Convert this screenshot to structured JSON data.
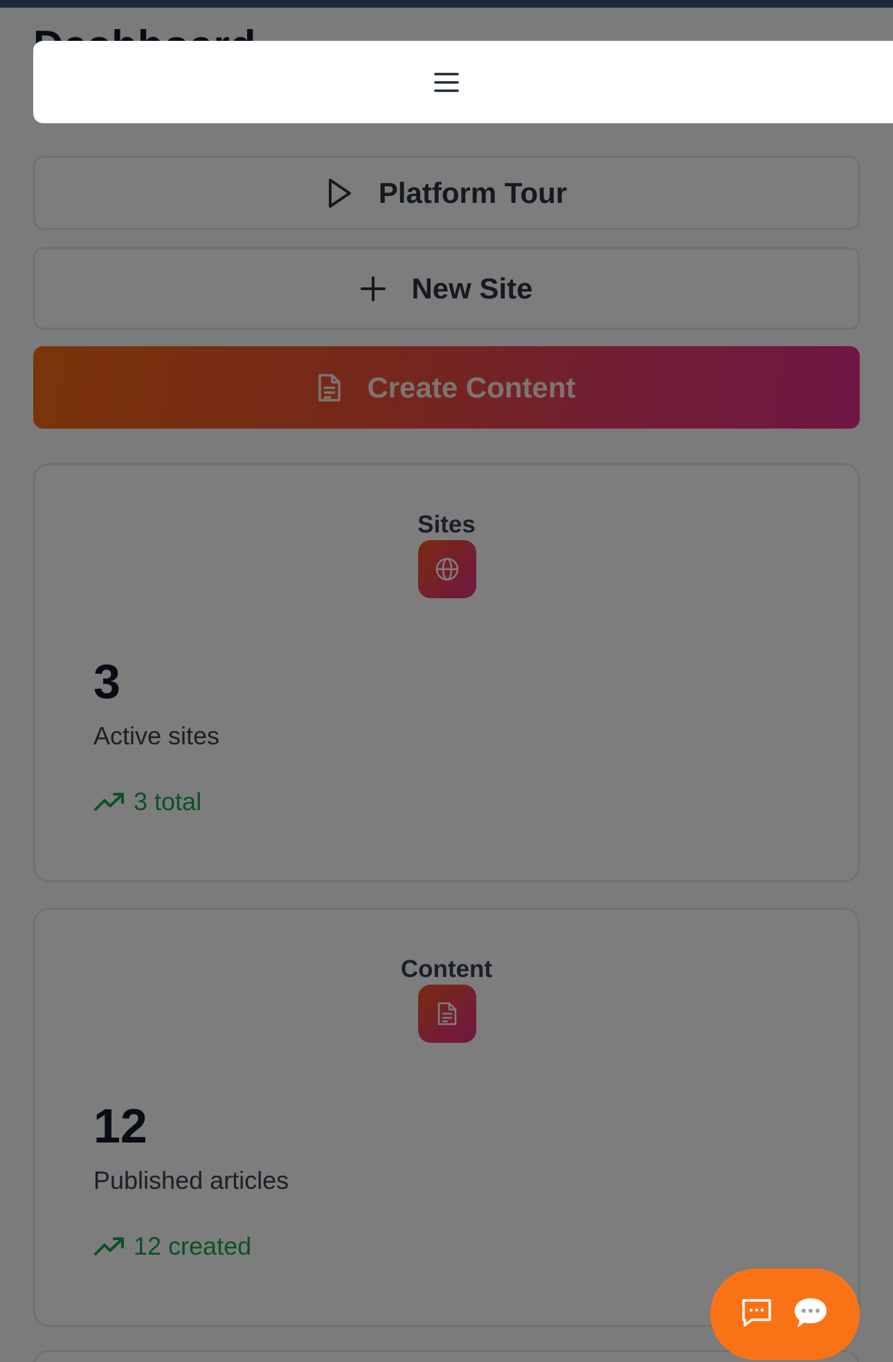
{
  "page": {
    "title": "Dashboard"
  },
  "actions": {
    "tour_label": "Platform Tour",
    "new_site_label": "New Site",
    "create_content_label": "Create Content"
  },
  "stats": [
    {
      "heading": "Sites",
      "icon": "globe-icon",
      "value": "3",
      "caption": "Active sites",
      "trend": "3 total",
      "trend_icon": "trending-up-icon"
    },
    {
      "heading": "Content",
      "icon": "document-icon",
      "value": "12",
      "caption": "Published articles",
      "trend": "12 created",
      "trend_icon": "trending-up-icon"
    }
  ],
  "menu": {
    "icon": "hamburger-menu-icon"
  },
  "chat": {
    "icons": [
      "message-square-icon",
      "chat-bubble-icon"
    ]
  },
  "colors": {
    "accent_orange": "#f97316",
    "accent_pink": "#df2e8a",
    "trend_green": "#16a34a",
    "topbar": "#1e293b"
  }
}
